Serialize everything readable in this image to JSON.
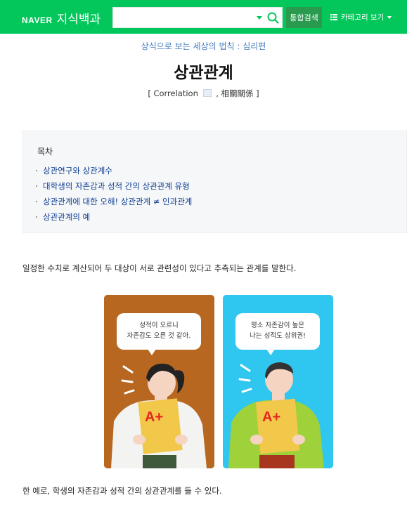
{
  "header": {
    "brand": "NAVER",
    "service": "지식백과",
    "search_value": "",
    "search_button": "통합검색",
    "category_button": "카테고리 보기"
  },
  "article": {
    "breadcrumb": "상식으로 보는 세상의 법칙 : 심리편",
    "title": "상관관계",
    "subtitle_open": "[ Correlation",
    "subtitle_close": ", 相關關係 ]",
    "intro": "일정한 수치로 계산되어 두 대상이 서로 관련성이 있다고 추측되는 관계를 말한다.",
    "example": "한 예로, 학생의 자존감과 성적 간의 상관관계를 들 수 있다."
  },
  "toc": {
    "title": "목차",
    "items": [
      "상관연구와 상관계수",
      "대학생의 자존감과 성적 간의 상관관계 유형",
      "상관관계에 대한 오해! 상관관계 ≠ 인과관계",
      "상관관계의 예"
    ]
  },
  "illustration": {
    "left_bubble_line1": "성적이 오르니",
    "left_bubble_line2": "자존감도 오른 것 같아.",
    "right_bubble_line1": "평소 자존감이 높은",
    "right_bubble_line2": "나는 성적도 상위권!",
    "paper_grade": "A+"
  },
  "colors": {
    "naver_green": "#03c75a",
    "link_blue": "#0b3d91",
    "breadcrumb_blue": "#4a7fc1",
    "left_panel": "#b7671f",
    "right_panel": "#2fc6ef"
  },
  "icons": [
    "dropdown-arrow-icon",
    "search-icon",
    "list-icon",
    "caret-down-icon",
    "speaker-icon"
  ]
}
